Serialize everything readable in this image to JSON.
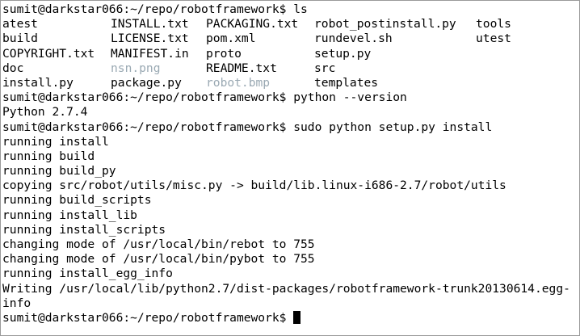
{
  "colors": {
    "file": "#000000",
    "directory": "#6f9fcf",
    "executable": "#7fbe3a",
    "image": "#9aa9b3",
    "background": "#ffffff"
  },
  "lines": {
    "cmd_ls": "sumit@darkstar066:~/repo/robotframework$ ls",
    "cmd_version": "sumit@darkstar066:~/repo/robotframework$ python --version",
    "out_python_version": "Python 2.7.4",
    "cmd_install": "sumit@darkstar066:~/repo/robotframework$ sudo python setup.py install",
    "out_running_install": "running install",
    "out_running_build": "running build",
    "out_running_build_py": "running build_py",
    "out_copying": "copying src/robot/utils/misc.py -> build/lib.linux-i686-2.7/robot/utils",
    "out_running_build_scripts": "running build_scripts",
    "out_running_install_lib": "running install_lib",
    "out_running_install_scripts": "running install_scripts",
    "out_chmod_rebot": "changing mode of /usr/local/bin/rebot to 755",
    "out_chmod_pybot": "changing mode of /usr/local/bin/pybot to 755",
    "out_running_install_egg_info": "running install_egg_info",
    "out_writing": "Writing /usr/local/lib/python2.7/dist-packages/robotframework-trunk20130614.egg-",
    "out_writing_cont": "info",
    "prompt_final": "sumit@darkstar066:~/repo/robotframework$ "
  },
  "ls_rows": [
    [
      {
        "name": "atest",
        "kind": "directory"
      },
      {
        "name": "INSTALL.txt",
        "kind": "file"
      },
      {
        "name": "PACKAGING.txt",
        "kind": "file"
      },
      {
        "name": "robot_postinstall.py",
        "kind": "file"
      },
      {
        "name": "tools",
        "kind": "directory"
      }
    ],
    [
      {
        "name": "build",
        "kind": "directory"
      },
      {
        "name": "LICENSE.txt",
        "kind": "file"
      },
      {
        "name": "pom.xml",
        "kind": "file"
      },
      {
        "name": "rundevel.sh",
        "kind": "executable"
      },
      {
        "name": "utest",
        "kind": "directory"
      }
    ],
    [
      {
        "name": "COPYRIGHT.txt",
        "kind": "file"
      },
      {
        "name": "MANIFEST.in",
        "kind": "file"
      },
      {
        "name": "proto",
        "kind": "directory"
      },
      {
        "name": "setup.py",
        "kind": "executable"
      }
    ],
    [
      {
        "name": "doc",
        "kind": "directory"
      },
      {
        "name": "nsn.png",
        "kind": "image"
      },
      {
        "name": "README.txt",
        "kind": "file"
      },
      {
        "name": "src",
        "kind": "directory"
      }
    ],
    [
      {
        "name": "install.py",
        "kind": "executable"
      },
      {
        "name": "package.py",
        "kind": "executable"
      },
      {
        "name": "robot.bmp",
        "kind": "image"
      },
      {
        "name": "templates",
        "kind": "directory"
      }
    ]
  ]
}
